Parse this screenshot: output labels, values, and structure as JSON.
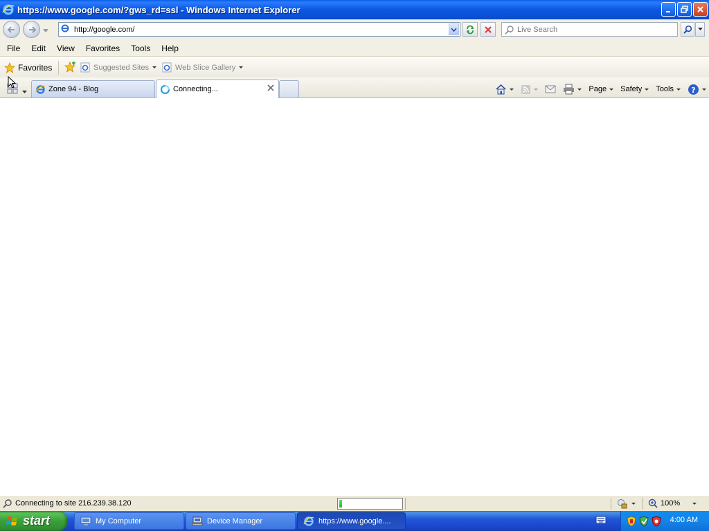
{
  "window": {
    "title": "https://www.google.com/?gws_rd=ssl - Windows Internet Explorer"
  },
  "address_bar": {
    "url": "http://google.com/",
    "search_placeholder": "Live Search"
  },
  "menu": {
    "items": [
      "File",
      "Edit",
      "View",
      "Favorites",
      "Tools",
      "Help"
    ]
  },
  "favorites_bar": {
    "favorites_label": "Favorites",
    "suggested_sites": "Suggested Sites",
    "web_slice_gallery": "Web Slice Gallery"
  },
  "tabs": [
    {
      "label": "Zone 94 - Blog"
    },
    {
      "label": "Connecting..."
    }
  ],
  "command_bar": {
    "page": "Page",
    "safety": "Safety",
    "tools": "Tools"
  },
  "status_bar": {
    "text": "Connecting to site 216.239.38.120",
    "progress": 0.05,
    "zoom": "100%"
  },
  "taskbar": {
    "start": "start",
    "buttons": [
      {
        "label": "My Computer"
      },
      {
        "label": "Device Manager"
      },
      {
        "label": "https://www.google...."
      }
    ],
    "clock": "4:00 AM"
  },
  "colors": {
    "titlebar": "#0b58e0",
    "taskbar": "#2157d7",
    "start_button": "#3aa03a",
    "chrome": "#f2f0e4"
  }
}
